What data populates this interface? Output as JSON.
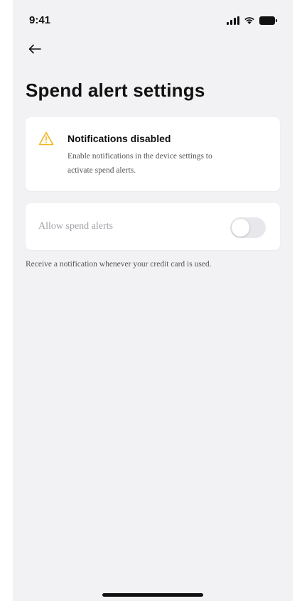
{
  "status_bar": {
    "time": "9:41",
    "icons": [
      "signal-icon",
      "wifi-icon",
      "battery-icon"
    ]
  },
  "header": {
    "back_icon": "arrow-left-icon",
    "title": "Spend alert settings"
  },
  "warning": {
    "icon": "warning-triangle-icon",
    "title": "Notifications disabled",
    "body": "Enable notifications in the device settings to activate spend alerts.",
    "icon_color": "#f2b51c"
  },
  "spend_alerts": {
    "label": "Allow spend alerts",
    "enabled": false,
    "helper_text": "Receive a notification whenever your credit card is used."
  },
  "colors": {
    "background": "#f2f2f4",
    "card": "#ffffff",
    "accent_warning": "#f2b51c",
    "disabled_text": "#a0a0a6"
  }
}
